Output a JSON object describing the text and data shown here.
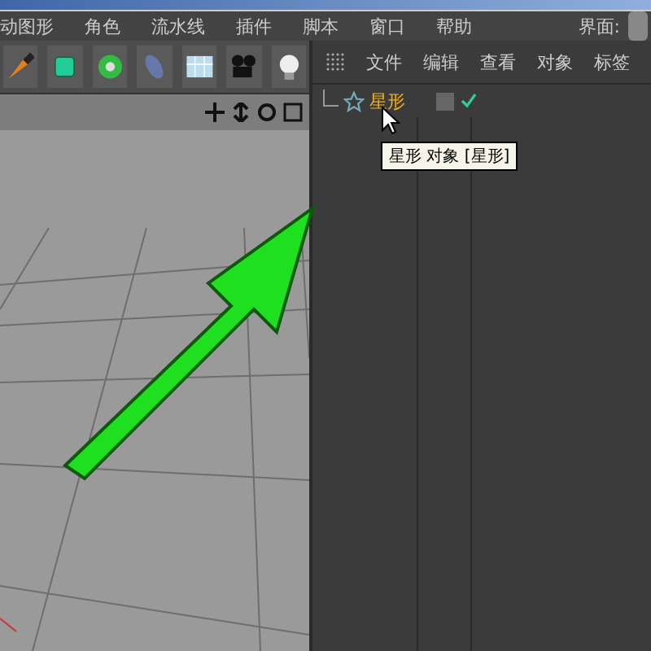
{
  "menu_bar": {
    "items": [
      "动图形",
      "角色",
      "流水线",
      "插件",
      "脚本",
      "窗口",
      "帮助"
    ],
    "layout_label": "界面:"
  },
  "object_manager": {
    "menu": [
      "文件",
      "编辑",
      "查看",
      "对象",
      "标签"
    ],
    "objects": [
      {
        "name": "星形",
        "selected": true,
        "enabled": true
      }
    ],
    "tooltip": "星形 对象 [星形]"
  }
}
